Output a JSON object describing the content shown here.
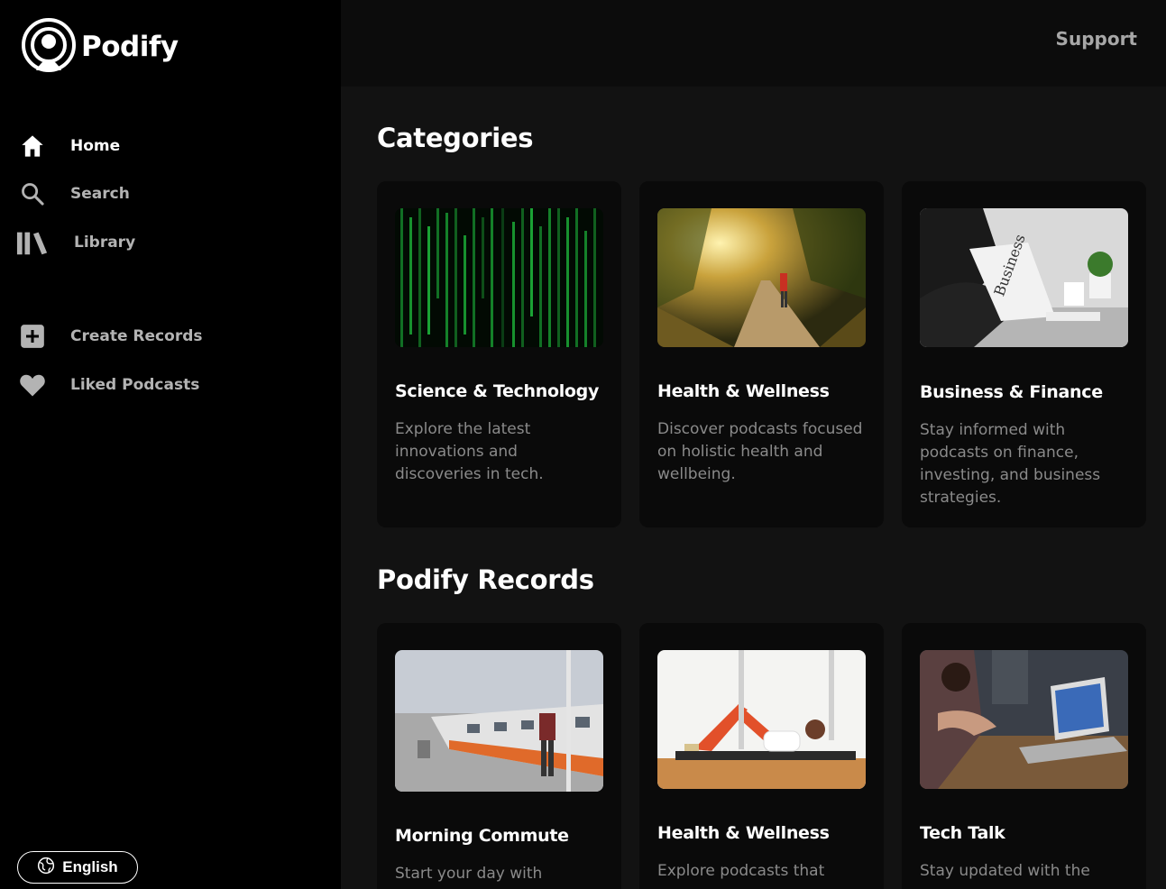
{
  "app": {
    "name": "Podify"
  },
  "sidebar": {
    "items": [
      {
        "label": "Home",
        "icon": "home-icon"
      },
      {
        "label": "Search",
        "icon": "search-icon"
      },
      {
        "label": "Library",
        "icon": "library-icon"
      },
      {
        "label": "Create Records",
        "icon": "plus-square-icon"
      },
      {
        "label": "Liked Podcasts",
        "icon": "heart-icon"
      }
    ],
    "language": "English"
  },
  "header": {
    "support_label": "Support"
  },
  "categories": {
    "title": "Categories",
    "cards": [
      {
        "title": "Science & Technology",
        "description": "Explore the latest innovations and discoveries in tech."
      },
      {
        "title": "Health & Wellness",
        "description": "Discover podcasts focused on holistic health and wellbeing."
      },
      {
        "title": "Business & Finance",
        "description": "Stay informed with podcasts on finance, investing, and business strategies."
      }
    ]
  },
  "records": {
    "title": "Podify Records",
    "cards": [
      {
        "title": "Morning Commute",
        "description": "Start your day with"
      },
      {
        "title": "Health & Wellness",
        "description": "Explore podcasts that"
      },
      {
        "title": "Tech Talk",
        "description": "Stay updated with the"
      }
    ]
  },
  "colors": {
    "background": "#121212",
    "sidebar": "#000000",
    "card": "#0a0a0a",
    "muted_text": "#8a8a8a"
  }
}
